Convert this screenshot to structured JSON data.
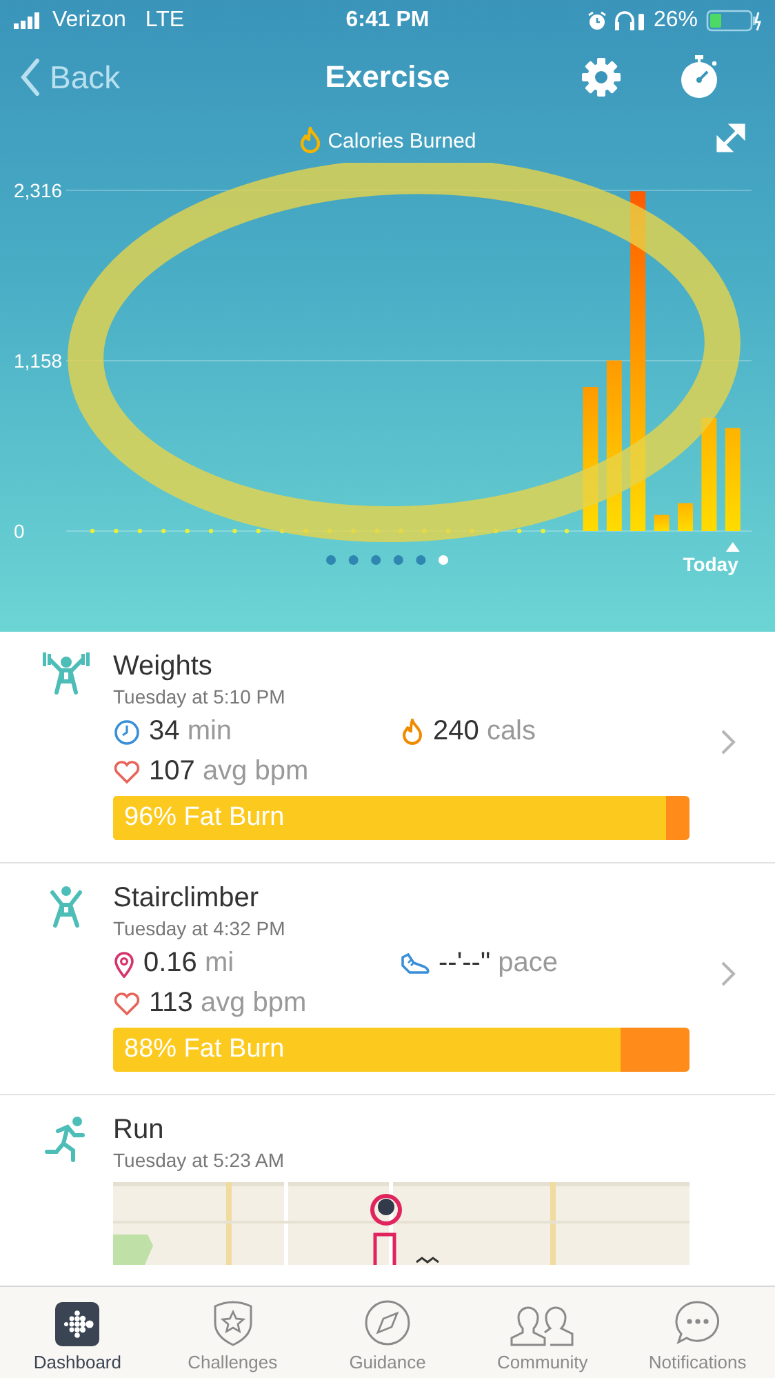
{
  "status_bar": {
    "carrier": "Verizon",
    "network": "LTE",
    "time": "6:41 PM",
    "battery": "26%"
  },
  "nav": {
    "back": "Back",
    "title": "Exercise"
  },
  "chart": {
    "today_label": "Today",
    "pages": [
      {
        "selected": false
      },
      {
        "selected": false
      },
      {
        "selected": false
      },
      {
        "selected": false
      },
      {
        "selected": false
      },
      {
        "selected": true
      }
    ],
    "chart_data": {
      "type": "bar",
      "title": "Calories Burned",
      "ylim": [
        0,
        2316
      ],
      "yticks": [
        {
          "value": 0,
          "label": "0"
        },
        {
          "value": 1158,
          "label": "1,158"
        },
        {
          "value": 2316,
          "label": "2,316"
        }
      ],
      "values": [
        0,
        0,
        0,
        0,
        0,
        0,
        0,
        0,
        0,
        0,
        0,
        0,
        0,
        0,
        0,
        0,
        0,
        0,
        0,
        0,
        0,
        980,
        1160,
        2310,
        110,
        190,
        770,
        700
      ]
    },
    "highlight": {
      "kind": "ellipse",
      "color": "#e6d34a"
    }
  },
  "activities": [
    {
      "kind": "weights",
      "name": "Weights",
      "time": "Tuesday at 5:10 PM",
      "stats": [
        {
          "kind": "duration",
          "value": "34",
          "unit": "min"
        },
        {
          "kind": "calories",
          "value": "240",
          "unit": "cals"
        },
        {
          "kind": "heart",
          "value": "107",
          "unit": "avg bpm"
        }
      ],
      "zone": {
        "label": "96% Fat Burn",
        "level": 0.96
      }
    },
    {
      "kind": "stairclimber",
      "name": "Stairclimber",
      "time": "Tuesday at 4:32 PM",
      "stats": [
        {
          "kind": "distance",
          "value": "0.16",
          "unit": "mi"
        },
        {
          "kind": "pace",
          "value": "--'--\"",
          "unit": "pace"
        },
        {
          "kind": "heart",
          "value": "113",
          "unit": "avg bpm"
        }
      ],
      "zone": {
        "label": "88% Fat Burn",
        "level": 0.88
      }
    },
    {
      "kind": "run",
      "name": "Run",
      "time": "Tuesday at 5:23 AM"
    }
  ],
  "tabs": [
    {
      "label": "Dashboard",
      "kind": "dashboard",
      "selected": true
    },
    {
      "label": "Challenges",
      "kind": "challenges",
      "selected": false
    },
    {
      "label": "Guidance",
      "kind": "guidance",
      "selected": false
    },
    {
      "label": "Community",
      "kind": "community",
      "selected": false
    },
    {
      "label": "Notifications",
      "kind": "notifications",
      "selected": false
    }
  ]
}
